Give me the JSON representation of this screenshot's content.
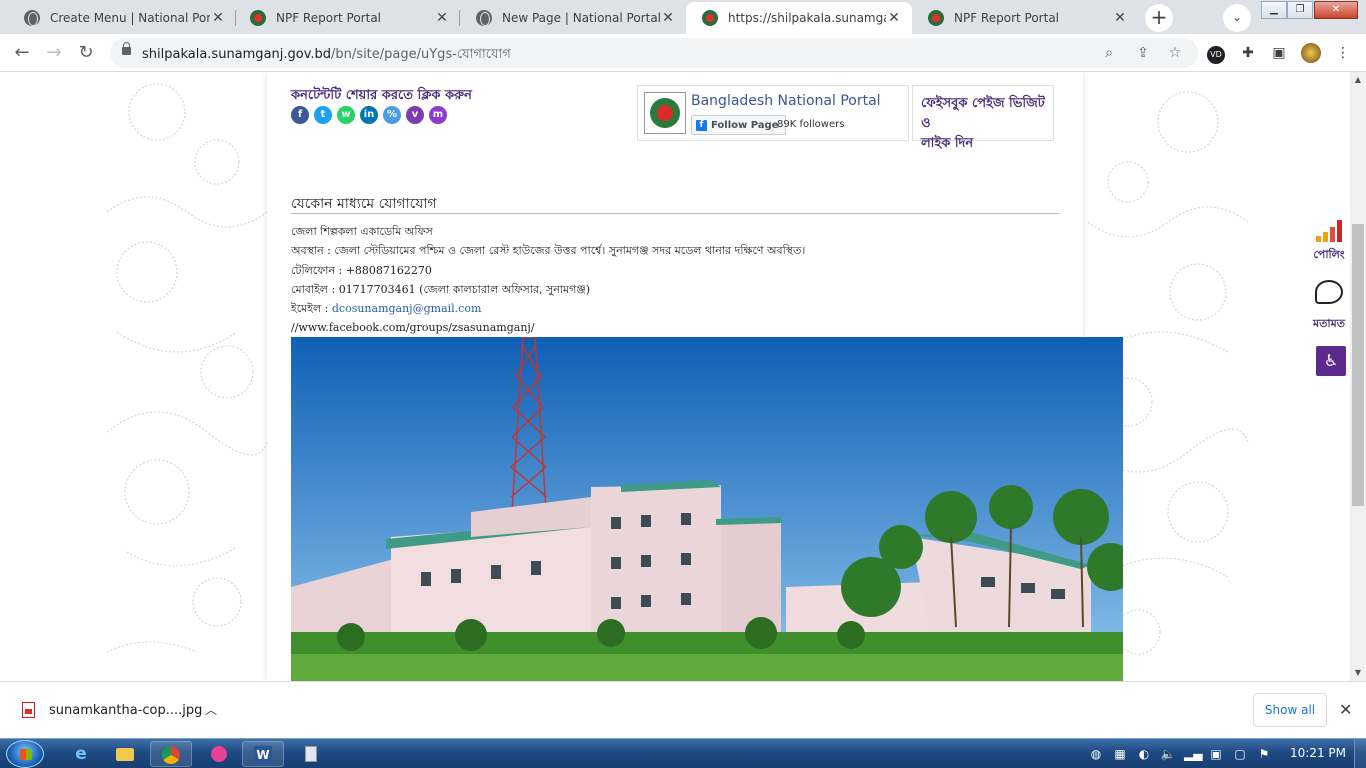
{
  "browser": {
    "tabs": [
      {
        "title": "Create Menu | National Portal",
        "icon": "globe-icon",
        "active": false
      },
      {
        "title": "NPF Report Portal",
        "icon": "bd-portal-icon",
        "active": false
      },
      {
        "title": "New Page | National Portal",
        "icon": "globe-icon",
        "active": false
      },
      {
        "title": "https://shilpakala.sunamganj.g",
        "icon": "bd-portal-icon",
        "active": true
      },
      {
        "title": "NPF Report Portal",
        "icon": "bd-portal-icon",
        "active": false
      }
    ],
    "new_tab_symbol": "+",
    "url_host": "shilpakala.sunamganj.gov.bd",
    "url_path": "/bn/site/page/uYgs-যোগাযোগ",
    "profile_badge": "VD"
  },
  "page": {
    "share_title": "কনটেন্টটি শেয়ার করতে ক্লিক করুন",
    "share_buttons": [
      {
        "glyph": "f",
        "color": "#3b5998"
      },
      {
        "glyph": "t",
        "color": "#1da1f2"
      },
      {
        "glyph": "w",
        "color": "#25d366"
      },
      {
        "glyph": "in",
        "color": "#0077b5"
      },
      {
        "glyph": "%",
        "color": "#4a9be8"
      },
      {
        "glyph": "v",
        "color": "#7d3daf"
      },
      {
        "glyph": "m",
        "color": "#8c3bd1"
      }
    ],
    "facebook": {
      "page_name": "Bangladesh National Portal",
      "follow_label": "Follow Page",
      "followers": "89K followers",
      "visit_text_1": "ফেইসবুক পেইজ ভিজিট ও",
      "visit_text_2": "লাইক দিন"
    },
    "contact_heading": "যেকোন মাধ্যমে যোগাযোগ",
    "contact": {
      "office": "জেলা শিল্পকলা একাডেমি অফিস",
      "location": "অবস্থান : জেলা স্টেডিয়ামের পশ্চিম ও জেলা রেস্ট হাউজের উত্তর পার্শ্বে। সুনামগঞ্জ সদর মডেল থানার দক্ষিণে অবস্থিত।",
      "phone": "টেলিফোন : +88087162270",
      "mobile": "মোবাইল : 01717703461 (জেলা কালচারাল অফিসার, সুনামগঞ্জ)",
      "email_label": "ইমেইল : ",
      "email": "dcosunamganj@gmail.com",
      "facebook_url": "//www.facebook.com/groups/zsasunamganj/"
    },
    "side_widgets": {
      "poll_label": "পোলিং",
      "feedback_label": "মতামত"
    }
  },
  "downloads": {
    "file_name": "sunamkantha-cop....jpg",
    "show_all": "Show all"
  },
  "taskbar": {
    "clock": "10:21 PM"
  }
}
